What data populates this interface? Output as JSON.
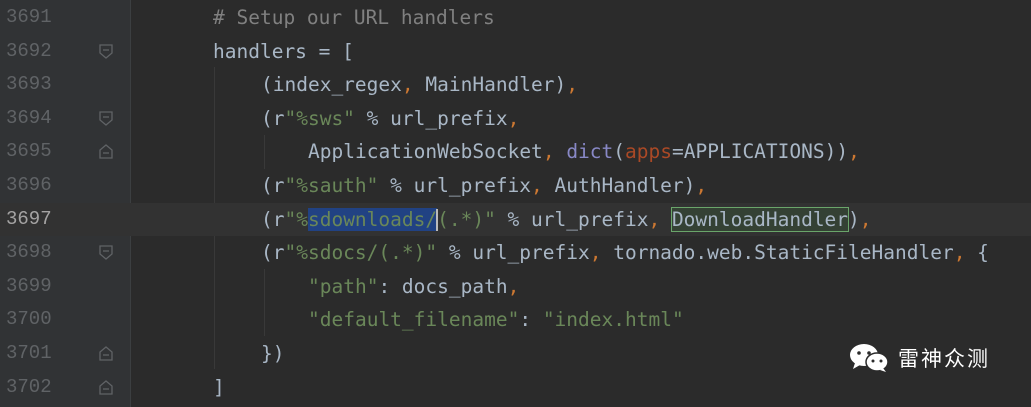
{
  "lines": [
    {
      "num": "3691",
      "tokens": [
        {
          "t": "# Setup our URL handlers",
          "c": "cmt"
        }
      ]
    },
    {
      "num": "3692",
      "tokens": [
        {
          "t": "handlers = [",
          "c": ""
        }
      ]
    },
    {
      "num": "3693",
      "tokens": [
        {
          "t": "(index_regex",
          "c": ""
        },
        {
          "t": ",",
          "c": "kw"
        },
        {
          "t": " MainHandler)",
          "c": ""
        },
        {
          "t": ",",
          "c": "kw"
        }
      ]
    },
    {
      "num": "3694",
      "tokens": [
        {
          "t": "(r",
          "c": ""
        },
        {
          "t": "\"%sws\"",
          "c": "str"
        },
        {
          "t": " % url_prefix",
          "c": ""
        },
        {
          "t": ",",
          "c": "kw"
        }
      ]
    },
    {
      "num": "3695",
      "tokens": [
        {
          "t": "ApplicationWebSocket",
          "c": ""
        },
        {
          "t": ",",
          "c": "kw"
        },
        {
          "t": " ",
          "c": ""
        },
        {
          "t": "dict",
          "c": "bi"
        },
        {
          "t": "(",
          "c": ""
        },
        {
          "t": "apps",
          "c": "par"
        },
        {
          "t": "=APPLICATIONS))",
          "c": ""
        },
        {
          "t": ",",
          "c": "kw"
        }
      ]
    },
    {
      "num": "3696",
      "tokens": [
        {
          "t": "(r",
          "c": ""
        },
        {
          "t": "\"%sauth\"",
          "c": "str"
        },
        {
          "t": " % url_prefix",
          "c": ""
        },
        {
          "t": ",",
          "c": "kw"
        },
        {
          "t": " AuthHandler)",
          "c": ""
        },
        {
          "t": ",",
          "c": "kw"
        }
      ]
    },
    {
      "num": "3697",
      "tokens": [
        {
          "t": "(r",
          "c": ""
        },
        {
          "t": "\"%",
          "c": "str"
        },
        {
          "t": "sdownloads/",
          "c": "str-sel"
        },
        {
          "t": "|",
          "c": "caret"
        },
        {
          "t": "(.*)\"",
          "c": "str"
        },
        {
          "t": " % url_prefix",
          "c": ""
        },
        {
          "t": ",",
          "c": "kw"
        },
        {
          "t": " ",
          "c": ""
        },
        {
          "t": "DownloadHandler",
          "c": "hl"
        },
        {
          "t": ")",
          "c": ""
        },
        {
          "t": ",",
          "c": "kw"
        }
      ]
    },
    {
      "num": "3698",
      "tokens": [
        {
          "t": "(r",
          "c": ""
        },
        {
          "t": "\"%sdocs/(.*)\"",
          "c": "str"
        },
        {
          "t": " % url_prefix",
          "c": ""
        },
        {
          "t": ",",
          "c": "kw"
        },
        {
          "t": " tornado.web.StaticFileHandler",
          "c": ""
        },
        {
          "t": ",",
          "c": "kw"
        },
        {
          "t": " {",
          "c": ""
        }
      ]
    },
    {
      "num": "3699",
      "tokens": [
        {
          "t": "\"path\"",
          "c": "str"
        },
        {
          "t": ": docs_path",
          "c": ""
        },
        {
          "t": ",",
          "c": "kw"
        }
      ]
    },
    {
      "num": "3700",
      "tokens": [
        {
          "t": "\"default_filename\"",
          "c": "str"
        },
        {
          "t": ": ",
          "c": ""
        },
        {
          "t": "\"index.html\"",
          "c": "str"
        }
      ]
    },
    {
      "num": "3701",
      "tokens": [
        {
          "t": "})",
          "c": ""
        }
      ]
    },
    {
      "num": "3702",
      "tokens": [
        {
          "t": "]",
          "c": ""
        }
      ]
    }
  ],
  "watermark": {
    "text": "雷神众测"
  },
  "colors": {
    "background": "#2b2b2b",
    "gutter": "#313335",
    "comment": "#808080",
    "string": "#6a8759",
    "keyword": "#cc7832",
    "builtin": "#8888c6",
    "param": "#aa4926",
    "selection": "#214283"
  }
}
